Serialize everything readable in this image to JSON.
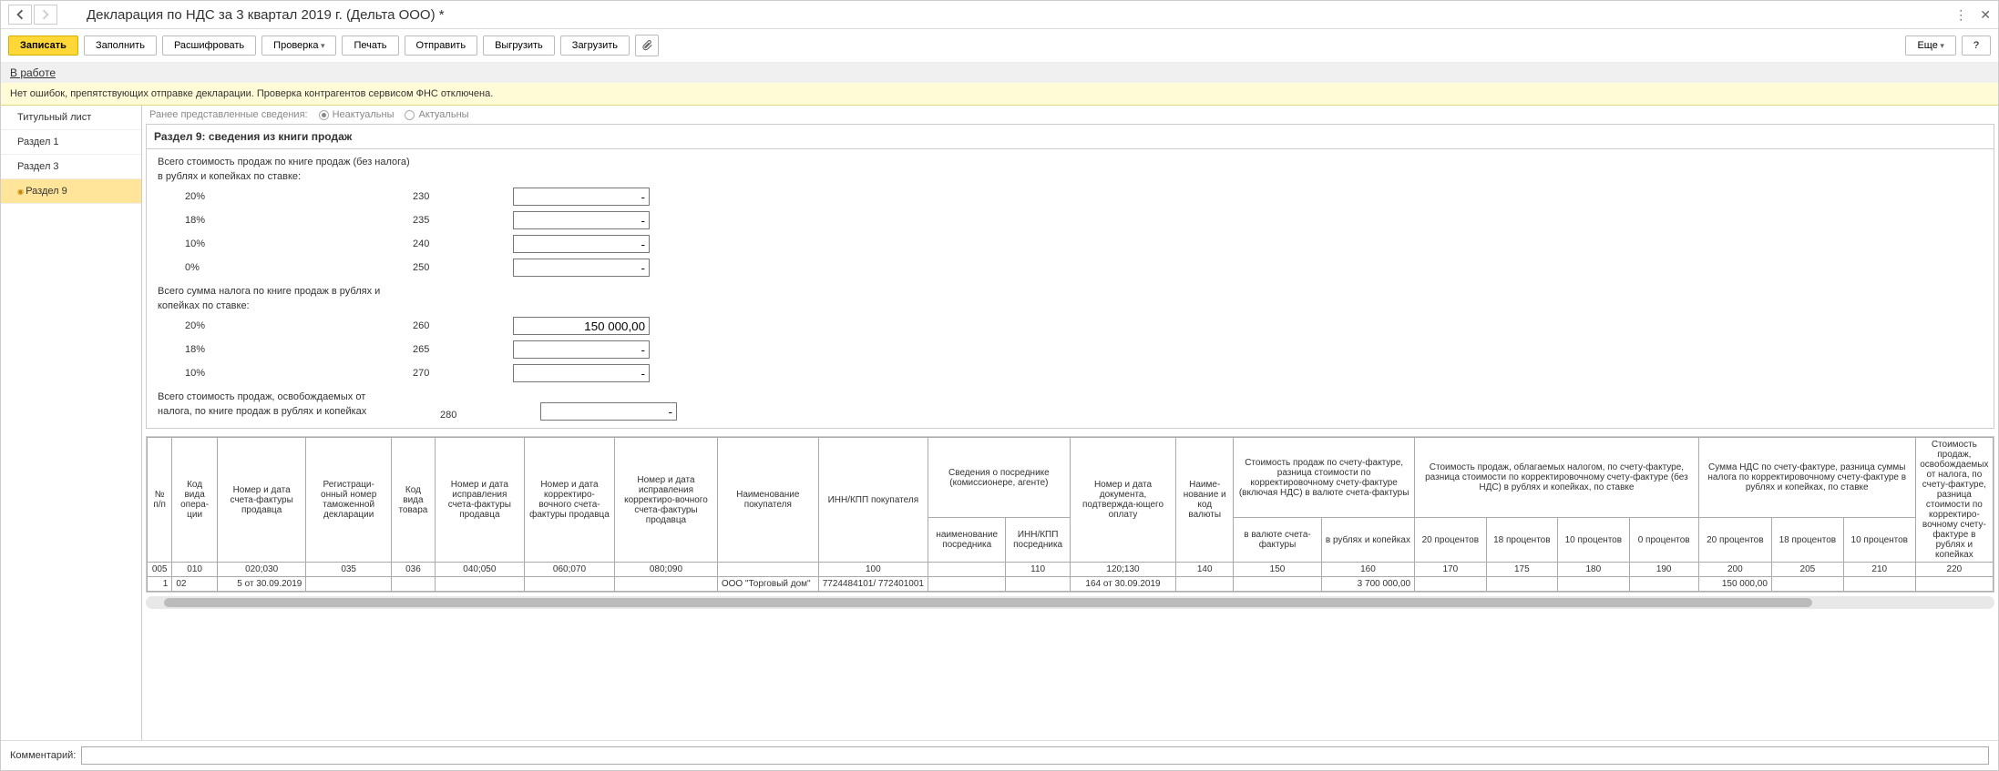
{
  "window": {
    "title": "Декларация по НДС за 3 квартал 2019 г. (Дельта ООО) *"
  },
  "toolbar": {
    "save": "Записать",
    "fill": "Заполнить",
    "decrypt": "Расшифровать",
    "check": "Проверка",
    "print": "Печать",
    "send": "Отправить",
    "upload": "Выгрузить",
    "download": "Загрузить",
    "more": "Еще",
    "help": "?"
  },
  "status": {
    "text": "В работе"
  },
  "info": {
    "text": "Нет ошибок, препятствующих отправке декларации. Проверка контрагентов сервисом ФНС отключена."
  },
  "sidebar": {
    "items": [
      {
        "label": "Титульный лист"
      },
      {
        "label": "Раздел 1"
      },
      {
        "label": "Раздел 3"
      },
      {
        "label": "Раздел 9"
      }
    ]
  },
  "prev": {
    "label": "Ранее представленные сведения:",
    "opt_irrelevant": "Неактуальны",
    "opt_relevant": "Актуальны"
  },
  "section": {
    "title": "Раздел 9: сведения из книги продаж",
    "sales_total_label_1": "Всего стоимость продаж по книге продаж (без налога)",
    "sales_total_label_2": "в рублях и копейках по ставке:",
    "tax_total_label_1": "Всего сумма налога по книге продаж в рублях и",
    "tax_total_label_2": "копейках по ставке:",
    "exempt_label_1": "Всего стоимость продаж, освобождаемых от",
    "exempt_label_2": "налога, по книге продаж в рублях и копейках",
    "rows_sales": [
      {
        "rate": "20%",
        "code": "230",
        "value": "-"
      },
      {
        "rate": "18%",
        "code": "235",
        "value": "-"
      },
      {
        "rate": "10%",
        "code": "240",
        "value": "-"
      },
      {
        "rate": "0%",
        "code": "250",
        "value": "-"
      }
    ],
    "rows_tax": [
      {
        "rate": "20%",
        "code": "260",
        "value": "150 000,00"
      },
      {
        "rate": "18%",
        "code": "265",
        "value": "-"
      },
      {
        "rate": "10%",
        "code": "270",
        "value": "-"
      }
    ],
    "rows_exempt": [
      {
        "rate": "",
        "code": "280",
        "value": "-"
      }
    ]
  },
  "table": {
    "headers": {
      "col_num": "№ п/п",
      "col_opcode": "Код вида опера-ции",
      "col_invoice_seller": "Номер и дата счета-фактуры продавца",
      "col_regnum": "Регистраци-онный номер таможенной декларации",
      "col_goods_code": "Код вида товара",
      "col_correction_invoice": "Номер и дата исправления счета-фактуры продавца",
      "col_adj_invoice": "Номер и дата корректиро-вочного счета-фактуры продавца",
      "col_adj_correction": "Номер и дата исправления корректиро-вочного счета-фактуры продавца",
      "col_buyer_name": "Наименование покупателя",
      "col_buyer_innkpp": "ИНН/КПП покупателя",
      "col_intermediary": "Сведения о посреднике (комиссионере, агенте)",
      "col_intermediary_name": "наименование посредника",
      "col_intermediary_innkpp": "ИНН/КПП посредника",
      "col_payment_doc": "Номер и дата документа, подтвержда-ющего оплату",
      "col_currency": "Наиме-нование и код валюты",
      "col_cost_currency_group": "Стоимость продаж по счету-фактуре, разница стоимости по корректировочному счету-фактуре (включая НДС) в валюте счета-фактуры",
      "col_in_currency": "в валюте счета-фактуры",
      "col_in_rubles": "в рублях и копейках",
      "col_taxable_group": "Стоимость продаж, облагаемых налогом, по счету-фактуре, разница стоимости по корректировочному счету-фактуре (без НДС) в рублях и копейках, по ставке",
      "col_20p": "20 процентов",
      "col_18p": "18 процентов",
      "col_10p": "10 процентов",
      "col_0p": "0 процентов",
      "col_vat_group": "Сумма НДС по счету-фактуре, разница суммы налога по корректировочному счету-фактуре в рублях и копейках, по ставке",
      "col_vat20": "20 процентов",
      "col_vat18": "18 процентов",
      "col_vat10": "10 процентов",
      "col_exempt": "Стоимость продаж, освобождаемых от налога, по счету-фактуре, разница стоимости по корректиро-вочному счету-фактуре в рублях и копейках"
    },
    "codes": [
      "005",
      "010",
      "020;030",
      "035",
      "036",
      "040;050",
      "060;070",
      "080;090",
      "",
      "100",
      "",
      "110",
      "120;130",
      "140",
      "150",
      "160",
      "170",
      "175",
      "180",
      "190",
      "200",
      "205",
      "210",
      "220"
    ],
    "row1": {
      "num": "1",
      "opcode": "02",
      "invoice": "5 от 30.09.2019",
      "buyer_name": "ООО \"Торговый дом\"",
      "buyer_innkpp": "7724484101/ 772401001",
      "payment_doc": "164 от 30.09.2019",
      "in_rubles": "3 700 000,00",
      "vat20": "150 000,00"
    }
  },
  "comment": {
    "label": "Комментарий:"
  }
}
